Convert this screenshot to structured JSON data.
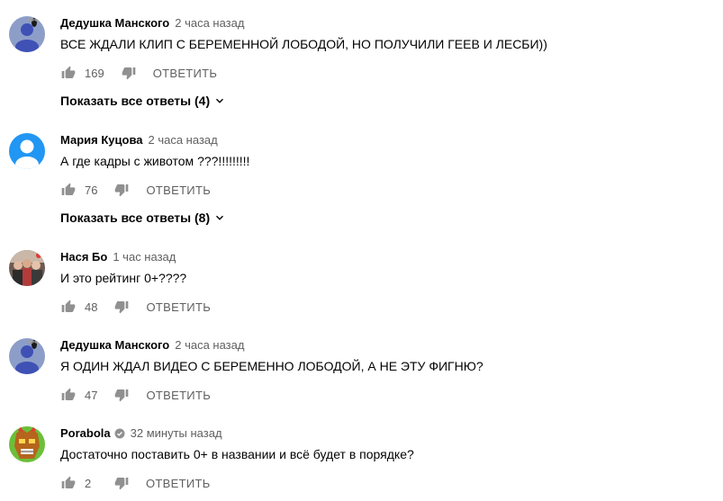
{
  "comments": [
    {
      "author": "Дедушка Манского",
      "time": "2 часа назад",
      "text": "ВСЕ ЖДАЛИ КЛИП С БЕРЕМЕННОЙ ЛОБОДОЙ, НО ПОЛУЧИЛИ ГЕЕВ И ЛЕСБИ))",
      "likes": "169",
      "reply_label": "ОТВЕТИТЬ",
      "show_replies": "Показать все ответы (4)",
      "avatar": "default-avatar-with-fly"
    },
    {
      "author": "Мария Куцова",
      "time": "2 часа назад",
      "text": "А где кадры с животом ???!!!!!!!!!",
      "likes": "76",
      "reply_label": "ОТВЕТИТЬ",
      "show_replies": "Показать все ответы (8)",
      "avatar": "default-avatar"
    },
    {
      "author": "Нася Бо",
      "time": "1 час назад",
      "text": "И это рейтинг 0+????",
      "likes": "48",
      "reply_label": "ОТВЕТИТЬ",
      "avatar": "group-photo-avatar"
    },
    {
      "author": "Дедушка Манского",
      "time": "2 часа назад",
      "text": "Я ОДИН ЖДАЛ ВИДЕО С БЕРЕМЕННО ЛОБОДОЙ, А НЕ ЭТУ ФИГНЮ?",
      "likes": "47",
      "reply_label": "ОТВЕТИТЬ",
      "avatar": "default-avatar-with-fly"
    },
    {
      "author": "Porabola",
      "time": "32 минуты назад",
      "text": "Достаточно поставить 0+ в названии и всё будет в порядке?",
      "likes": "2",
      "reply_label": "ОТВЕТИТЬ",
      "verified": true,
      "avatar": "crash-bandicoot-mask-avatar"
    }
  ],
  "colors": {
    "text": "#030303",
    "secondary": "#606060",
    "icon": "#909090",
    "default_avatar_bg": "#8c9ec8",
    "default_avatar_blue": "#2196f3"
  }
}
